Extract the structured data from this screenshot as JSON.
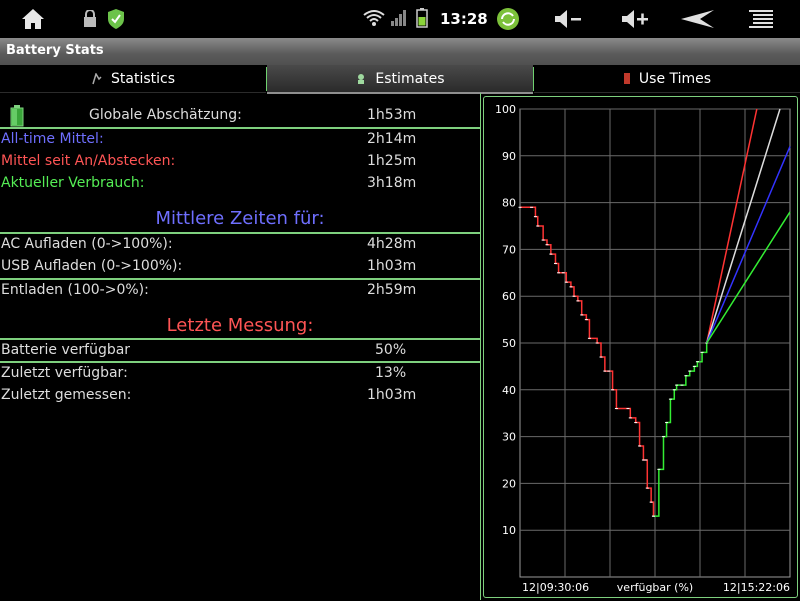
{
  "status_bar": {
    "time": "13:28",
    "icons": [
      "home-icon",
      "lock-icon",
      "shield-icon",
      "wifi-icon",
      "signal-icon",
      "battery-icon",
      "sync-icon",
      "volume-down-icon",
      "volume-up-icon",
      "back-icon",
      "menu-icon"
    ]
  },
  "app": {
    "title": "Battery Stats"
  },
  "tabs": [
    {
      "label": "Statistics",
      "active": false
    },
    {
      "label": "Estimates",
      "active": true
    },
    {
      "label": "Use Times",
      "active": false
    }
  ],
  "estimates": {
    "global": {
      "label": "Globale Abschätzung:",
      "value": "1h53m"
    },
    "alltime": {
      "label": "All-time Mittel:",
      "value": "2h14m",
      "color": "#6f6fff"
    },
    "since_plug": {
      "label": "Mittel seit An/Abstecken:",
      "value": "1h25m",
      "color": "#ff5555"
    },
    "current": {
      "label": "Aktueller Verbrauch:",
      "value": "3h18m",
      "color": "#55ee55"
    }
  },
  "mean_times": {
    "heading": "Mittlere Zeiten für:",
    "heading_color": "#6f6fff",
    "ac": {
      "label": "AC Aufladen (0->100%):",
      "value": "4h28m"
    },
    "usb": {
      "label": "USB Aufladen (0->100%):",
      "value": "1h03m"
    },
    "discharge": {
      "label": "Entladen (100->0%):",
      "value": "2h59m"
    }
  },
  "last_measurement": {
    "heading": "Letzte Messung:",
    "heading_color": "#ff5555",
    "available": {
      "label": "Batterie verfügbar",
      "value": "50%"
    },
    "last_available": {
      "label": "Zuletzt verfügbar:",
      "value": "13%"
    },
    "last_measured": {
      "label": "Zuletzt gemessen:",
      "value": "1h03m"
    }
  },
  "chart_data": {
    "type": "line",
    "ylim": [
      0,
      100
    ],
    "yticks": [
      "10",
      "20",
      "30",
      "40",
      "50",
      "60",
      "70",
      "80",
      "90",
      "100"
    ],
    "x_start_label": "12|09:30:06",
    "x_mid_label": "verfügbar (%)",
    "x_end_label": "12|15:22:06",
    "colors": {
      "discharge": "#ff3333",
      "charge": "#33ee33",
      "alltime": "#3333ff",
      "global": "#dddddd"
    },
    "discharge_points": [
      [
        0,
        79
      ],
      [
        1.5,
        79
      ],
      [
        2,
        77
      ],
      [
        2.3,
        75
      ],
      [
        3,
        72
      ],
      [
        3.5,
        71
      ],
      [
        4,
        69
      ],
      [
        4.6,
        67
      ],
      [
        5,
        65
      ],
      [
        5.6,
        65
      ],
      [
        6,
        63
      ],
      [
        6.6,
        62
      ],
      [
        7,
        60
      ],
      [
        7.5,
        59
      ],
      [
        8,
        56
      ],
      [
        8.6,
        55
      ],
      [
        9,
        51
      ],
      [
        10,
        50
      ],
      [
        10.5,
        47
      ],
      [
        11,
        44
      ],
      [
        11.5,
        44
      ],
      [
        12,
        40
      ],
      [
        12.5,
        36
      ],
      [
        14,
        36
      ],
      [
        14.3,
        34
      ],
      [
        15,
        33
      ],
      [
        15.5,
        28
      ],
      [
        16,
        25
      ],
      [
        16.3,
        25
      ],
      [
        16.5,
        19
      ],
      [
        17,
        16
      ],
      [
        17.3,
        13
      ]
    ],
    "charge_points": [
      [
        17.3,
        13
      ],
      [
        18,
        23
      ],
      [
        18.6,
        30
      ],
      [
        19,
        33
      ],
      [
        19.5,
        38
      ],
      [
        20,
        40
      ],
      [
        20.3,
        41
      ],
      [
        21,
        41
      ],
      [
        21.5,
        43
      ],
      [
        22,
        44
      ],
      [
        22.6,
        45
      ],
      [
        23,
        46
      ],
      [
        23.6,
        48
      ],
      [
        24.2,
        50
      ]
    ],
    "projections": [
      {
        "name": "discharge",
        "end": [
          30.7,
          100
        ]
      },
      {
        "name": "global",
        "end": [
          33.7,
          100
        ]
      },
      {
        "name": "alltime",
        "end": [
          35,
          92
        ]
      },
      {
        "name": "charge",
        "end": [
          35,
          78
        ]
      }
    ],
    "xlim": [
      0,
      35
    ]
  }
}
